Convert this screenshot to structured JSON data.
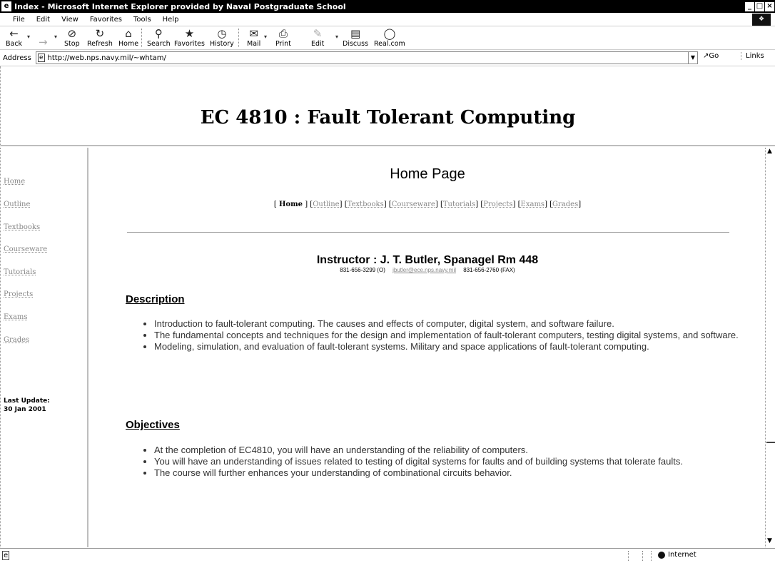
{
  "window": {
    "title": "Index - Microsoft Internet Explorer provided by Naval Postgraduate School",
    "controls": [
      "_",
      "□",
      "×"
    ]
  },
  "menu": [
    "File",
    "Edit",
    "View",
    "Favorites",
    "Tools",
    "Help"
  ],
  "toolbar": {
    "back": "Back",
    "stop": "Stop",
    "refresh": "Refresh",
    "home": "Home",
    "search": "Search",
    "favorites": "Favorites",
    "history": "History",
    "mail": "Mail",
    "print": "Print",
    "edit": "Edit",
    "discuss": "Discuss",
    "realcom": "Real.com"
  },
  "address": {
    "label": "Address",
    "url": "http://web.nps.navy.mil/~whtam/",
    "go": "Go",
    "links": "Links"
  },
  "banner": {
    "title": "EC 4810 : Fault Tolerant Computing"
  },
  "nav": {
    "items": [
      "Home",
      "Outline",
      "Textbooks",
      "Courseware",
      "Tutorials",
      "Projects",
      "Exams",
      "Grades"
    ],
    "last_update_label": "Last Update:",
    "last_update_date": "30 Jan 2001"
  },
  "main": {
    "heading": "Home Page",
    "crumbs": [
      "Home",
      "Outline",
      "Textbooks",
      "Courseware",
      "Tutorials",
      "Projects",
      "Exams",
      "Grades"
    ],
    "instructor": "Instructor :  J. T. Butler,  Spanagel Rm 448",
    "phone": "831-656-3299 (O)",
    "email": "jbutler@ece.nps.navy.mil",
    "fax": "831-656-2760 (FAX)",
    "description_title": "Description",
    "description": [
      "Introduction to fault-tolerant computing. The causes and effects of computer, digital system, and software failure.",
      "The fundamental concepts and techniques for the design and implementation of fault-tolerant computers, testing digital systems, and software.",
      "Modeling, simulation, and evaluation of fault-tolerant systems. Military and space applications of fault-tolerant computing."
    ],
    "objectives_title": "Objectives",
    "objectives": [
      "At the completion of EC4810, you will have an understanding of the reliability of computers.",
      "You will have an understanding of issues related to testing of digital systems for faults and of building systems that tolerate faults.",
      "The course will further enhances your understanding of combinational circuits behavior."
    ]
  },
  "status": {
    "zone": "Internet"
  }
}
